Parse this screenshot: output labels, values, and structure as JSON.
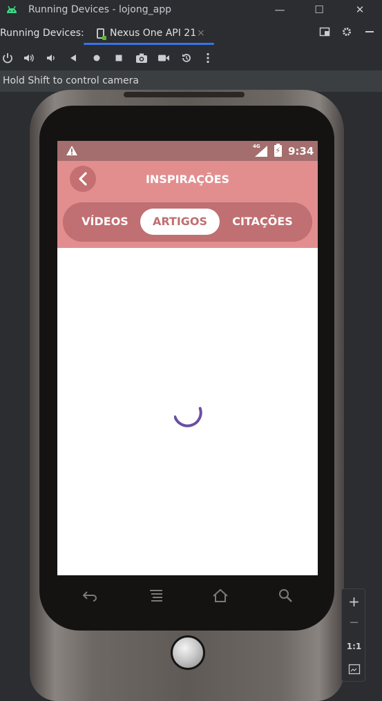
{
  "window": {
    "title": "Running Devices - lojong_app",
    "app_icon": "android-icon",
    "controls": {
      "minimize": "—",
      "maximize": "☐",
      "close": "✕"
    }
  },
  "tab_row": {
    "label": "Running Devices:",
    "tab_name": "Nexus One API 21",
    "tab_close": "×",
    "right_icons": [
      "layout-icon",
      "gear-icon",
      "minimize-icon"
    ]
  },
  "toolbar": {
    "icons": [
      "power-icon",
      "volume-up-icon",
      "volume-down-icon",
      "back-icon",
      "home-icon",
      "overview-icon",
      "camera-icon",
      "video-icon",
      "rotate-icon",
      "more-icon"
    ]
  },
  "hint": "Hold Shift to control camera",
  "device": {
    "status_bar": {
      "network": "4G",
      "time": "9:34",
      "battery_symbol": "⚡"
    },
    "app": {
      "title": "INSPIRAÇÕES",
      "tabs": [
        {
          "label": "VÍDEOS",
          "active": false
        },
        {
          "label": "ARTIGOS",
          "active": true
        },
        {
          "label": "CITAÇÕES",
          "active": false
        }
      ],
      "loading": true
    },
    "colors": {
      "status_bar": "#a36e6d",
      "app_bar": "#e38e8e",
      "segmented_bg": "#c06f72",
      "spinner": "#6a4fa3"
    }
  },
  "zoom": {
    "zoom_in": "+",
    "zoom_out": "−",
    "actual_size": "1:1",
    "fit": "fit-screen-icon"
  }
}
